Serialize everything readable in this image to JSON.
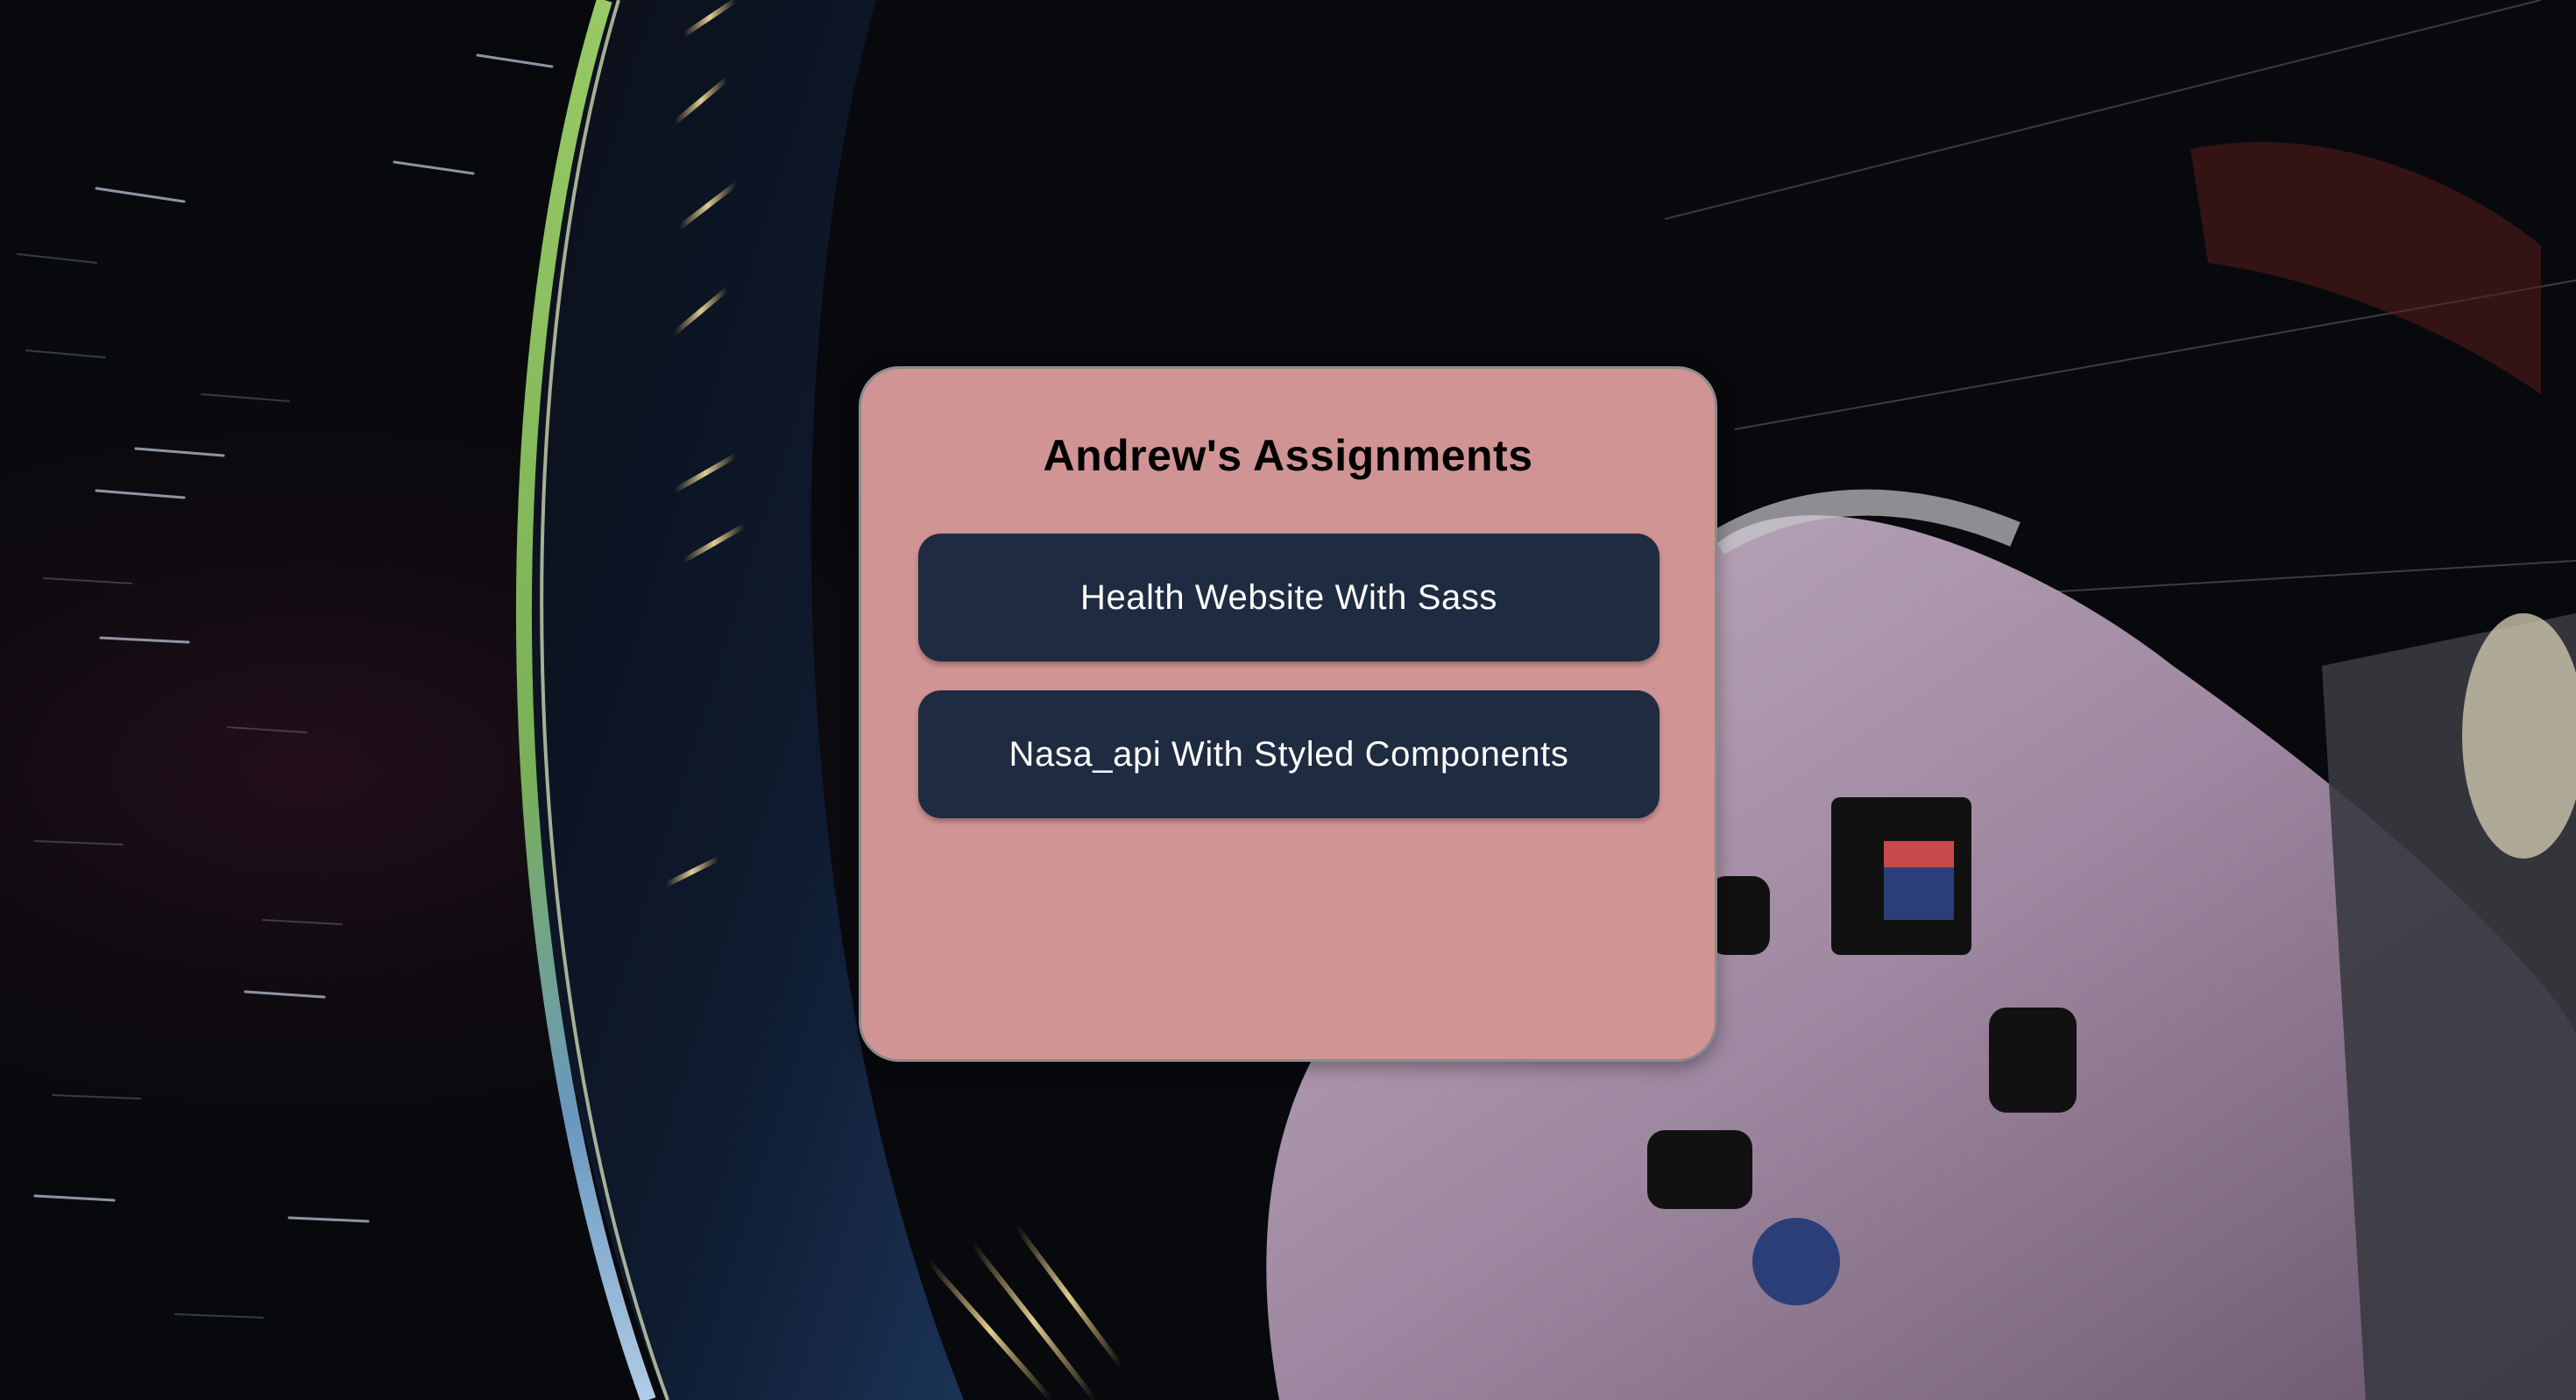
{
  "card": {
    "title": "Andrew's Assignments",
    "buttons": [
      {
        "label": "Health Website With Sass"
      },
      {
        "label": "Nasa_api With Styled Components"
      }
    ]
  },
  "colors": {
    "card_bg": "#d19494",
    "card_border": "#8a8a8a",
    "button_bg": "#1f2b41",
    "button_text": "#ffffff",
    "title_text": "#000000",
    "space_bg": "#07080c"
  },
  "background": {
    "icon": "space-photo-starliner-capsule"
  }
}
